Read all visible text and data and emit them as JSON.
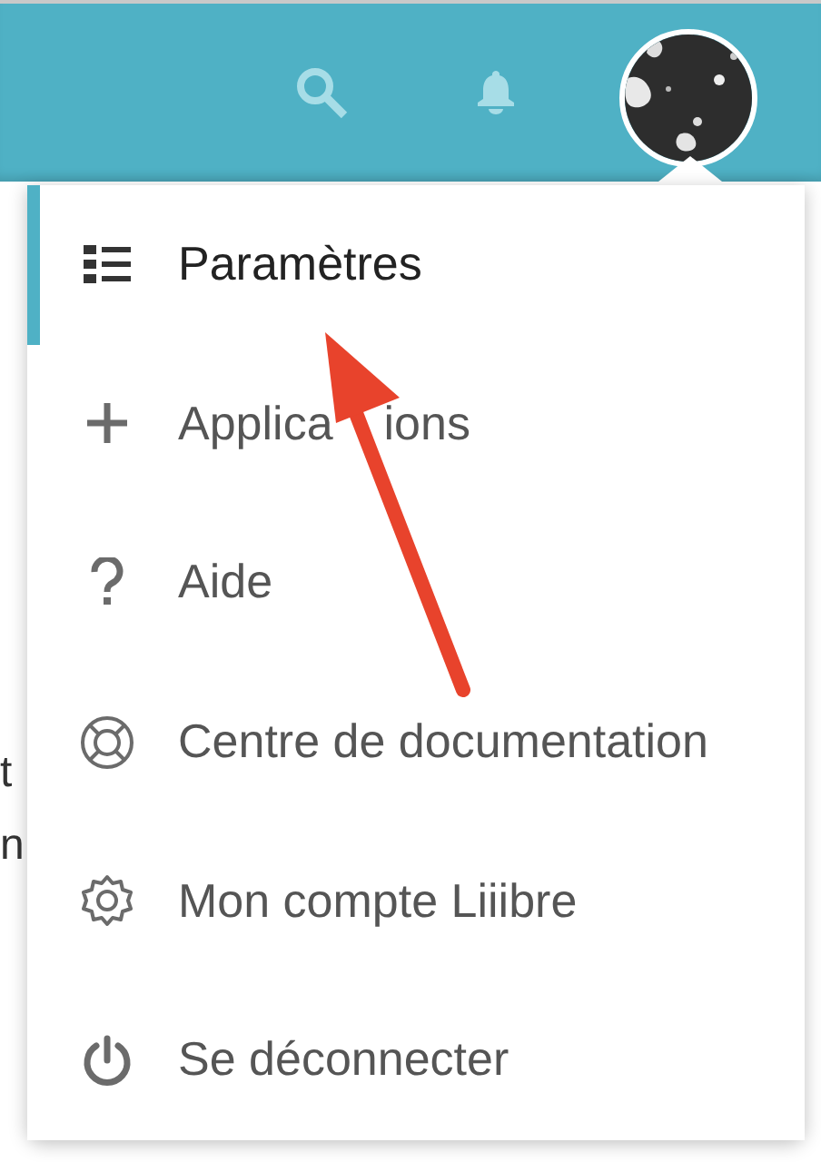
{
  "header": {
    "icons": [
      {
        "kind": "search"
      },
      {
        "kind": "notifications"
      }
    ]
  },
  "background_text": [
    "t",
    "n"
  ],
  "menu": {
    "items": [
      {
        "kind": "list",
        "label": "Paramètres",
        "selected": true
      },
      {
        "kind": "plus",
        "label": "Applica",
        "label_after_arrow": "ions",
        "selected": false
      },
      {
        "kind": "help",
        "label": "Aide",
        "selected": false
      },
      {
        "kind": "lifebuoy",
        "label": "Centre de documentation",
        "selected": false
      },
      {
        "kind": "gear",
        "label": "Mon compte Liiibre",
        "selected": false
      },
      {
        "kind": "power",
        "label": "Se déconnecter",
        "selected": false
      }
    ]
  },
  "annotation": {
    "kind": "arrow"
  }
}
